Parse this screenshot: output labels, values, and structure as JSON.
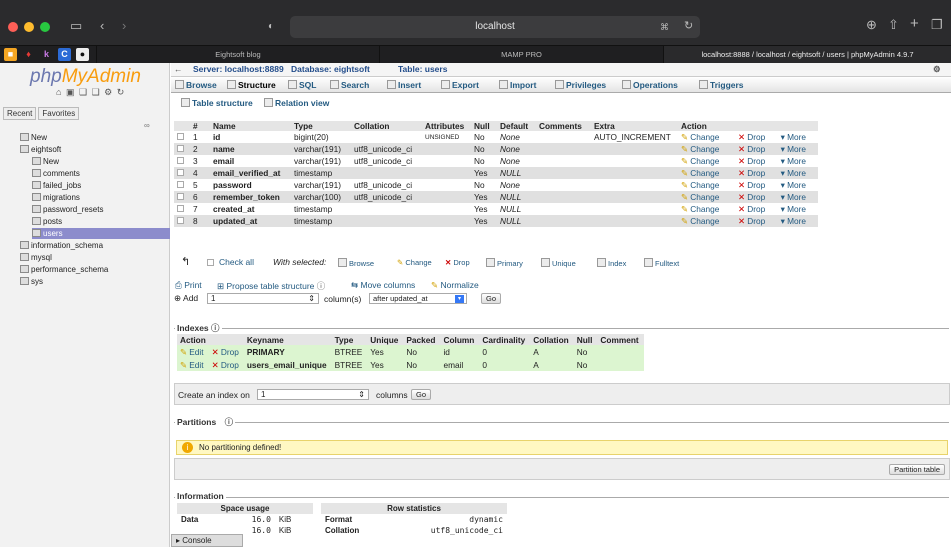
{
  "browser": {
    "url": "localhost",
    "tabs": [
      {
        "label": "Eightsoft blog"
      },
      {
        "label": "MAMP PRO"
      },
      {
        "label": "localhost:8888 / localhost / eightsoft / users | phpMyAdmin 4.9.7"
      }
    ]
  },
  "sidebar": {
    "logo_a": "php",
    "logo_b": "MyAdmin",
    "recent": "Recent",
    "favorites": "Favorites",
    "tree": [
      {
        "label": "New",
        "level": 0
      },
      {
        "label": "eightsoft",
        "level": 0
      },
      {
        "label": "New",
        "level": 1
      },
      {
        "label": "comments",
        "level": 1
      },
      {
        "label": "failed_jobs",
        "level": 1
      },
      {
        "label": "migrations",
        "level": 1
      },
      {
        "label": "password_resets",
        "level": 1
      },
      {
        "label": "posts",
        "level": 1
      },
      {
        "label": "users",
        "level": 1
      },
      {
        "label": "information_schema",
        "level": 0
      },
      {
        "label": "mysql",
        "level": 0
      },
      {
        "label": "performance_schema",
        "level": 0
      },
      {
        "label": "sys",
        "level": 0
      }
    ]
  },
  "breadcrumb": {
    "server": "Server: localhost:8889",
    "database": "Database: eightsoft",
    "table": "Table: users"
  },
  "nav_tabs": [
    "Browse",
    "Structure",
    "SQL",
    "Search",
    "Insert",
    "Export",
    "Import",
    "Privileges",
    "Operations",
    "Triggers"
  ],
  "sub_tabs": [
    "Table structure",
    "Relation view"
  ],
  "structure": {
    "headers": [
      "#",
      "Name",
      "Type",
      "Collation",
      "Attributes",
      "Null",
      "Default",
      "Comments",
      "Extra",
      "Action"
    ],
    "rows": [
      {
        "n": "1",
        "name": "id",
        "type": "bigint(20)",
        "collation": "",
        "attributes": "UNSIGNED",
        "null": "No",
        "default": "None",
        "comments": "",
        "extra": "AUTO_INCREMENT"
      },
      {
        "n": "2",
        "name": "name",
        "type": "varchar(191)",
        "collation": "utf8_unicode_ci",
        "attributes": "",
        "null": "No",
        "default": "None",
        "comments": "",
        "extra": ""
      },
      {
        "n": "3",
        "name": "email",
        "type": "varchar(191)",
        "collation": "utf8_unicode_ci",
        "attributes": "",
        "null": "No",
        "default": "None",
        "comments": "",
        "extra": ""
      },
      {
        "n": "4",
        "name": "email_verified_at",
        "type": "timestamp",
        "collation": "",
        "attributes": "",
        "null": "Yes",
        "default": "NULL",
        "comments": "",
        "extra": ""
      },
      {
        "n": "5",
        "name": "password",
        "type": "varchar(191)",
        "collation": "utf8_unicode_ci",
        "attributes": "",
        "null": "No",
        "default": "None",
        "comments": "",
        "extra": ""
      },
      {
        "n": "6",
        "name": "remember_token",
        "type": "varchar(100)",
        "collation": "utf8_unicode_ci",
        "attributes": "",
        "null": "Yes",
        "default": "NULL",
        "comments": "",
        "extra": ""
      },
      {
        "n": "7",
        "name": "created_at",
        "type": "timestamp",
        "collation": "",
        "attributes": "",
        "null": "Yes",
        "default": "NULL",
        "comments": "",
        "extra": ""
      },
      {
        "n": "8",
        "name": "updated_at",
        "type": "timestamp",
        "collation": "",
        "attributes": "",
        "null": "Yes",
        "default": "NULL",
        "comments": "",
        "extra": ""
      }
    ],
    "actions": {
      "change": "Change",
      "drop": "Drop",
      "more": "More"
    }
  },
  "bulk": {
    "check_all": "Check all",
    "with_selected": "With selected:",
    "items": [
      "Browse",
      "Change",
      "Drop",
      "Primary",
      "Unique",
      "Index",
      "Fulltext"
    ]
  },
  "tools": {
    "print": "Print",
    "propose": "Propose table structure",
    "move_columns": "Move columns",
    "normalize": "Normalize",
    "add": "Add",
    "add_count": "1",
    "columns_label": "column(s)",
    "position": "after updated_at",
    "go": "Go"
  },
  "indexes": {
    "legend": "Indexes",
    "headers": [
      "Action",
      "",
      "Keyname",
      "Type",
      "Unique",
      "Packed",
      "Column",
      "Cardinality",
      "Collation",
      "Null",
      "Comment"
    ],
    "rows": [
      {
        "keyname": "PRIMARY",
        "type": "BTREE",
        "unique": "Yes",
        "packed": "No",
        "column": "id",
        "cardinality": "0",
        "collation": "A",
        "null": "No",
        "comment": ""
      },
      {
        "keyname": "users_email_unique",
        "type": "BTREE",
        "unique": "Yes",
        "packed": "No",
        "column": "email",
        "cardinality": "0",
        "collation": "A",
        "null": "No",
        "comment": ""
      }
    ],
    "edit": "Edit",
    "drop": "Drop",
    "create_label": "Create an index on",
    "create_count": "1",
    "create_columns": "columns",
    "go": "Go"
  },
  "partitions": {
    "legend": "Partitions",
    "message": "No partitioning defined!",
    "button": "Partition table"
  },
  "information": {
    "legend": "Information",
    "space_usage": "Space usage",
    "row_statistics": "Row statistics",
    "space_rows": [
      {
        "label": "Data",
        "value": "16.0",
        "unit": "KiB"
      },
      {
        "label": "",
        "value": "16.0",
        "unit": "KiB"
      }
    ],
    "stat_rows": [
      {
        "label": "Format",
        "value": "dynamic"
      },
      {
        "label": "Collation",
        "value": "utf8_unicode_ci"
      }
    ]
  },
  "console": "Console"
}
